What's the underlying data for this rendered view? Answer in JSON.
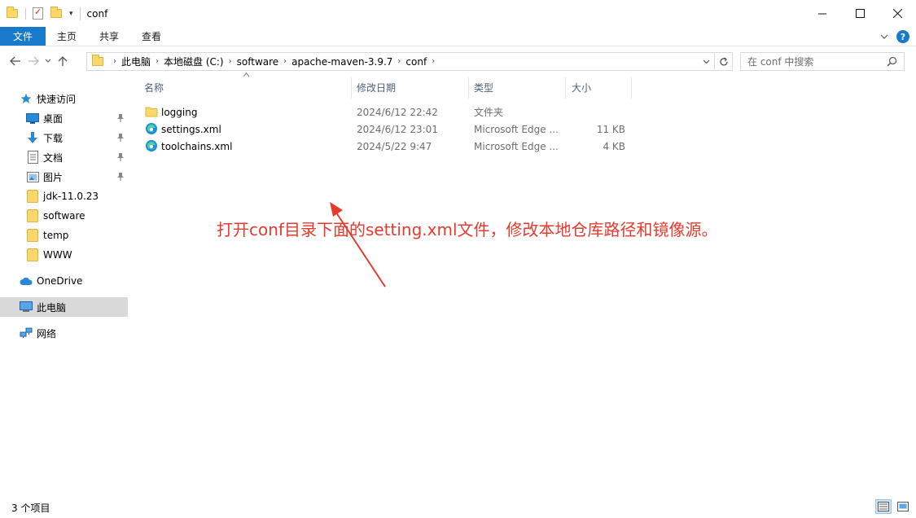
{
  "window": {
    "title": "conf",
    "minimize_label": "",
    "maximize_label": "",
    "close_label": ""
  },
  "ribbon": {
    "tabs": [
      "文件",
      "主页",
      "共享",
      "查看"
    ],
    "help": "?"
  },
  "address": {
    "crumbs": [
      "此电脑",
      "本地磁盘 (C:)",
      "software",
      "apache-maven-3.9.7",
      "conf"
    ]
  },
  "search": {
    "placeholder": "在 conf 中搜索"
  },
  "sidebar": {
    "items": [
      {
        "label": "快速访问",
        "icon": "star-icon"
      },
      {
        "label": "桌面",
        "icon": "desktop-icon",
        "pinned": true
      },
      {
        "label": "下载",
        "icon": "download-icon",
        "pinned": true
      },
      {
        "label": "文档",
        "icon": "document-icon",
        "pinned": true
      },
      {
        "label": "图片",
        "icon": "picture-icon",
        "pinned": true
      },
      {
        "label": "jdk-11.0.23",
        "icon": "folder-icon"
      },
      {
        "label": "software",
        "icon": "folder-icon"
      },
      {
        "label": "temp",
        "icon": "folder-icon"
      },
      {
        "label": "WWW",
        "icon": "folder-icon"
      },
      {
        "label": "OneDrive",
        "icon": "cloud-icon"
      },
      {
        "label": "此电脑",
        "icon": "computer-icon"
      },
      {
        "label": "网络",
        "icon": "network-icon"
      }
    ]
  },
  "columns": {
    "name": "名称",
    "date": "修改日期",
    "type": "类型",
    "size": "大小"
  },
  "files": [
    {
      "name": "logging",
      "date": "2024/6/12 22:42",
      "type": "文件夹",
      "size": "",
      "icon": "folder-icon"
    },
    {
      "name": "settings.xml",
      "date": "2024/6/12 23:01",
      "type": "Microsoft Edge ...",
      "size": "11 KB",
      "icon": "edge-icon"
    },
    {
      "name": "toolchains.xml",
      "date": "2024/5/22 9:47",
      "type": "Microsoft Edge ...",
      "size": "4 KB",
      "icon": "edge-icon"
    }
  ],
  "annotation": "打开conf目录下面的setting.xml文件，修改本地仓库路径和镜像源。",
  "status": {
    "count": "3 个项目"
  },
  "colors": {
    "accent": "#1979ca",
    "annotation": "#e53a2e",
    "folder": "#f8d76b"
  }
}
